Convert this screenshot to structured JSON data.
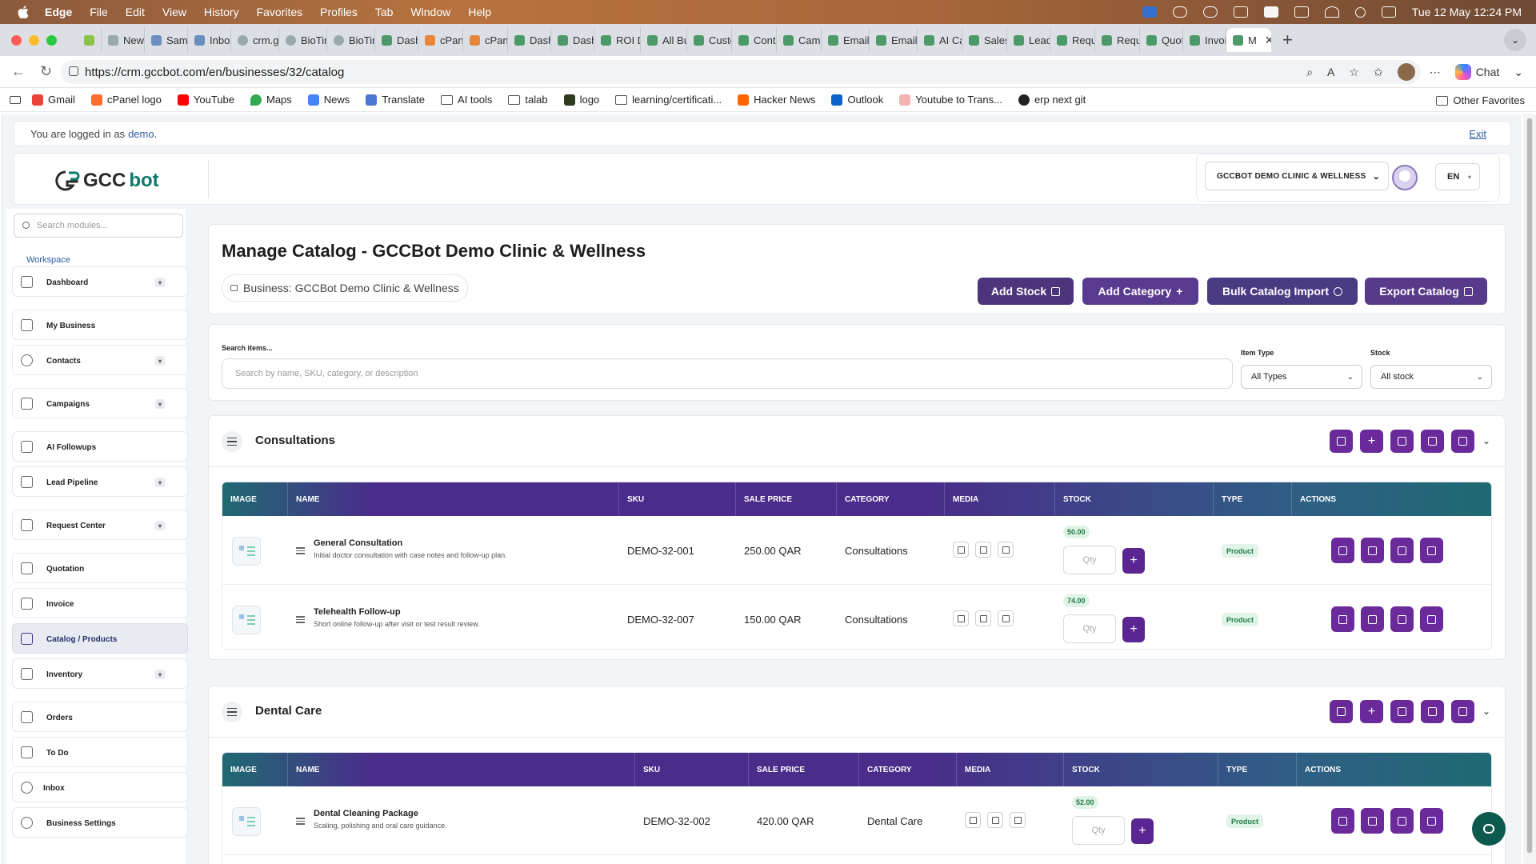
{
  "menubar": {
    "app": "Edge",
    "items": [
      "File",
      "Edit",
      "View",
      "History",
      "Favorites",
      "Profiles",
      "Tab",
      "Window",
      "Help"
    ],
    "datetime": "Tue 12 May  12:24 PM"
  },
  "tabs": [
    "New",
    "Same",
    "Inbox",
    "crm.g",
    "BioTir",
    "BioTir",
    "Dash",
    "cPan",
    "cPan",
    "Dash",
    "Dash",
    "ROI D",
    "All Bu",
    "Custo",
    "Conta",
    "Camp",
    "Email",
    "Email",
    "AI Ca",
    "Sales",
    "Lead",
    "Requ",
    "Requ",
    "Quot",
    "Invoi",
    "M"
  ],
  "address": {
    "url": "https://crm.gccbot.com/en/businesses/32/catalog",
    "chat_label": "Chat"
  },
  "bookmarks": {
    "items": [
      "Gmail",
      "cPanel logo",
      "YouTube",
      "Maps",
      "News",
      "Translate",
      "AI tools",
      "talab",
      "logo",
      "learning/certificati...",
      "Hacker News",
      "Outlook",
      "Youtube to Trans...",
      "erp next git"
    ],
    "other": "Other Favorites"
  },
  "login": {
    "prefix": "You are logged in as",
    "user": "demo",
    "suffix": ".",
    "exit": "Exit"
  },
  "header": {
    "logo_gcc": "GCC",
    "logo_bot": "bot",
    "business_select": "GCCBOT DEMO CLINIC & WELLNESS",
    "lang": "EN"
  },
  "sidebar": {
    "search_placeholder": "Search modules...",
    "workspace": "Workspace",
    "items": [
      {
        "label": "Dashboard",
        "chevron": true
      },
      {
        "label": "My Business",
        "chevron": false
      },
      {
        "label": "Contacts",
        "chevron": true
      },
      {
        "label": "Campaigns",
        "chevron": true
      },
      {
        "label": "AI Followups",
        "chevron": false
      },
      {
        "label": "Lead Pipeline",
        "chevron": true
      },
      {
        "label": "Request Center",
        "chevron": true
      },
      {
        "label": "Quotation",
        "chevron": false
      },
      {
        "label": "Invoice",
        "chevron": false
      },
      {
        "label": "Catalog / Products",
        "chevron": false,
        "active": true
      },
      {
        "label": "Inventory",
        "chevron": true
      },
      {
        "label": "Orders",
        "chevron": false
      },
      {
        "label": "To Do",
        "chevron": false
      },
      {
        "label": "Inbox",
        "chevron": false
      },
      {
        "label": "Business Settings",
        "chevron": false
      }
    ]
  },
  "page": {
    "title": "Manage Catalog - GCCBot Demo Clinic & Wellness",
    "business_chip": "Business: GCCBot Demo Clinic & Wellness",
    "buttons": {
      "add_stock": "Add Stock",
      "add_category": "Add Category",
      "bulk_import": "Bulk Catalog Import",
      "export": "Export Catalog"
    },
    "colors": {
      "add_stock": "#3e2370",
      "add_category": "#4a2a86",
      "bulk_import": "#3a2a78",
      "export": "#4a2a82"
    }
  },
  "search": {
    "label": "Search items...",
    "placeholder": "Search by name, SKU, category, or description",
    "item_type_label": "Item Type",
    "item_type_value": "All Types",
    "stock_label": "Stock",
    "stock_value": "All stock"
  },
  "table_headers": [
    "IMAGE",
    "NAME",
    "SKU",
    "SALE PRICE",
    "CATEGORY",
    "MEDIA",
    "STOCK",
    "TYPE",
    "ACTIONS"
  ],
  "categories": [
    {
      "name": "Consultations",
      "rows": [
        {
          "name": "General Consultation",
          "desc": "Initial doctor consultation with case notes and follow-up plan.",
          "sku": "DEMO-32-001",
          "price": "250.00 QAR",
          "category": "Consultations",
          "stock": "50.00",
          "qty_placeholder": "Qty",
          "type": "Product"
        },
        {
          "name": "Telehealth Follow-up",
          "desc": "Short online follow-up after visit or test result review.",
          "sku": "DEMO-32-007",
          "price": "150.00 QAR",
          "category": "Consultations",
          "stock": "74.00",
          "qty_placeholder": "Qty",
          "type": "Product"
        }
      ]
    },
    {
      "name": "Dental Care",
      "rows": [
        {
          "name": "Dental Cleaning Package",
          "desc": "Scaling, polishing and oral care guidance.",
          "sku": "DEMO-32-002",
          "price": "420.00 QAR",
          "category": "Dental Care",
          "stock": "52.00",
          "qty_placeholder": "Qty",
          "type": "Product"
        }
      ]
    }
  ]
}
